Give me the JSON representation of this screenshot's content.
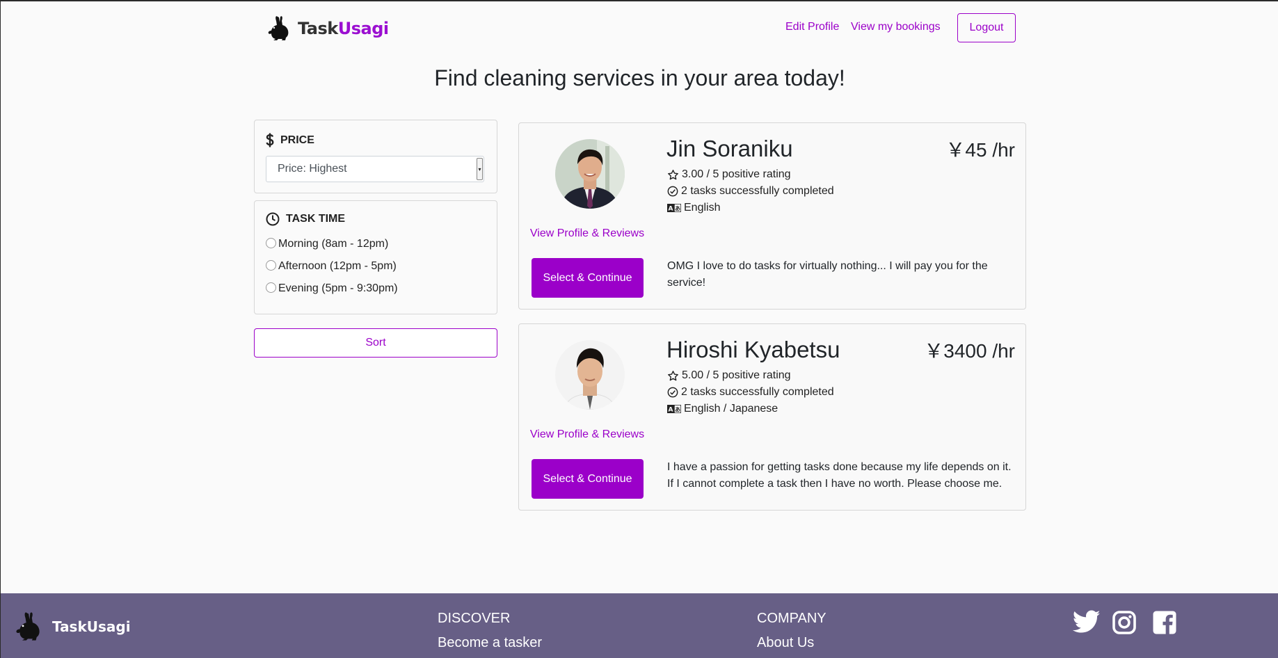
{
  "brand": {
    "part1": "Task",
    "part2": "Usagi",
    "full": "TaskUsagi",
    "accent": "#9b00c9"
  },
  "nav": {
    "edit_profile": "Edit Profile",
    "bookings": "View my bookings",
    "logout": "Logout"
  },
  "page": {
    "title": "Find cleaning services in your area today!"
  },
  "filters": {
    "price": {
      "heading": "PRICE",
      "icon": "dollar-icon",
      "selected": "Price: Highest"
    },
    "task_time": {
      "heading": "TASK TIME",
      "icon": "clock-icon",
      "options": [
        "Morning (8am - 12pm)",
        "Afternoon (12pm - 5pm)",
        "Evening (5pm - 9:30pm)"
      ]
    },
    "sort_label": "Sort"
  },
  "taskers": [
    {
      "name": "Jin Soraniku",
      "price": "￥45 /hr",
      "rating": "3.00 / 5 positive rating",
      "tasks": "2 tasks successfully completed",
      "languages": "English",
      "profile_link": "View Profile & Reviews",
      "select_label": "Select & Continue",
      "description": "OMG I love to do tasks for virtually nothing... I will pay you for the service!"
    },
    {
      "name": "Hiroshi Kyabetsu",
      "price": "￥3400 /hr",
      "rating": "5.00 / 5 positive rating",
      "tasks": "2 tasks successfully completed",
      "languages": "English / Japanese",
      "profile_link": "View Profile & Reviews",
      "select_label": "Select & Continue",
      "description": "I have a passion for getting tasks done because my life depends on it. If I cannot complete a task then I have no worth. Please choose me."
    }
  ],
  "footer": {
    "brand": "TaskUsagi",
    "discover": {
      "heading": "DISCOVER",
      "links": [
        "Become a tasker"
      ]
    },
    "company": {
      "heading": "COMPANY",
      "links": [
        "About Us"
      ]
    },
    "social": [
      "twitter-icon",
      "instagram-icon",
      "facebook-icon"
    ],
    "color": "#675f86"
  }
}
